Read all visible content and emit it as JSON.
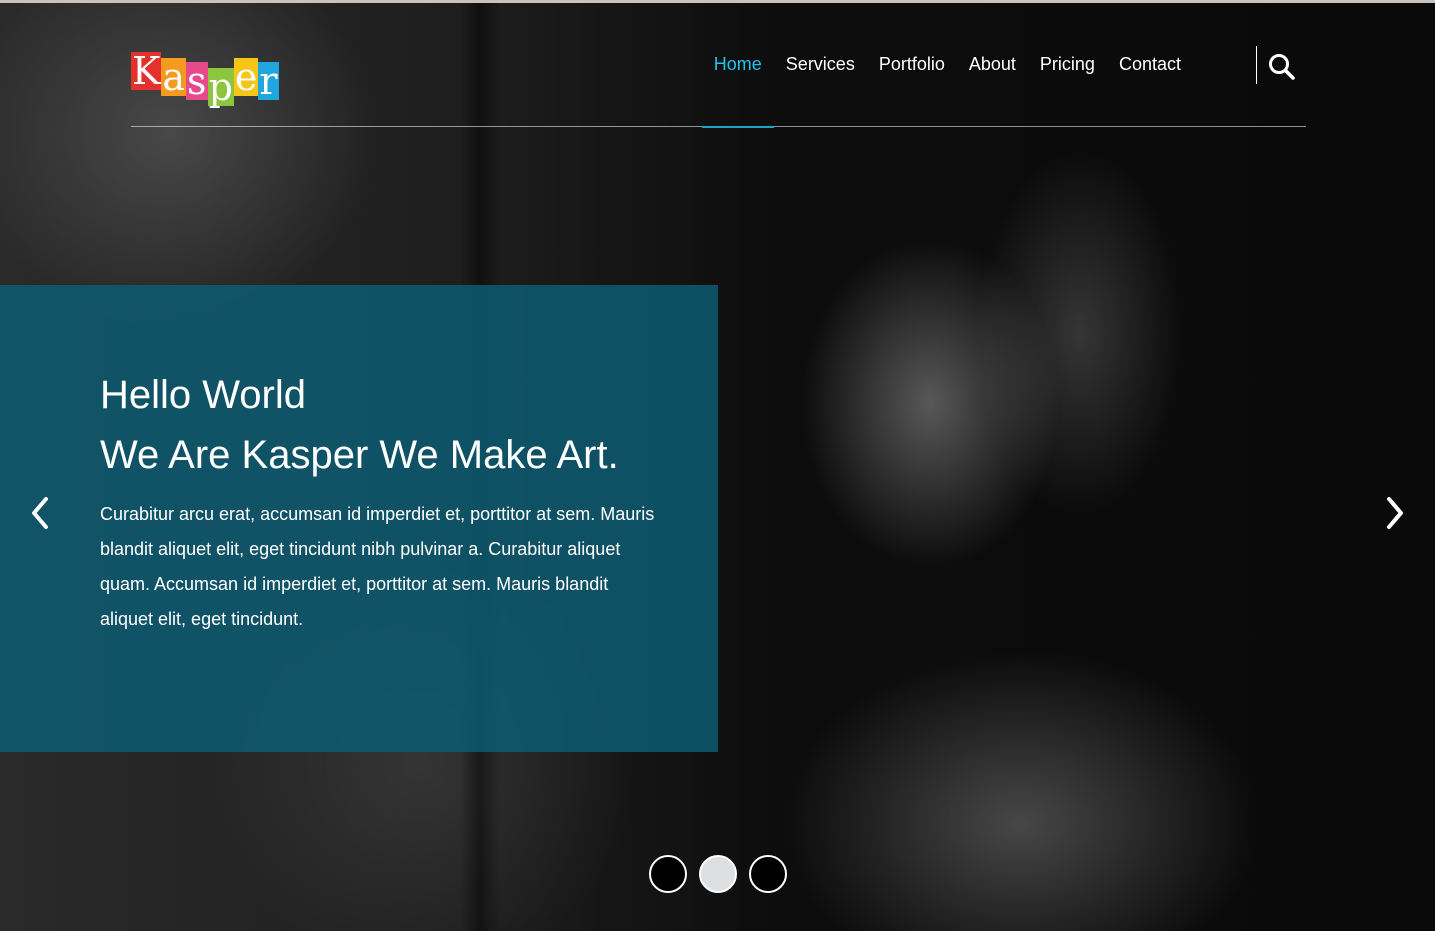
{
  "logo": {
    "text": "Kasper",
    "letter_colors": [
      "#e4312b",
      "#f39a1f",
      "#e64a8b",
      "#8cc63f",
      "#f5c518",
      "#1fa6dc"
    ]
  },
  "nav": {
    "items": [
      {
        "label": "Home",
        "active": true
      },
      {
        "label": "Services",
        "active": false
      },
      {
        "label": "Portfolio",
        "active": false
      },
      {
        "label": "About",
        "active": false
      },
      {
        "label": "Pricing",
        "active": false
      },
      {
        "label": "Contact",
        "active": false
      }
    ],
    "search_icon": "search-icon"
  },
  "hero": {
    "title_line1": "Hello World",
    "title_line2": "We Are Kasper We Make Art.",
    "description": "Curabitur arcu erat, accumsan id imperdiet et, porttitor at sem. Mauris blandit aliquet elit, eget tincidunt nibh pulvinar a. Curabitur aliquet quam. Accumsan id imperdiet et, porttitor at sem. Mauris blandit aliquet elit, eget tincidunt."
  },
  "slider": {
    "prev_icon": "chevron-left-icon",
    "next_icon": "chevron-right-icon",
    "slide_count": 3,
    "active_index": 1
  },
  "colors": {
    "accent": "#1fc2f0",
    "panel": "#0e5c72",
    "active_dot": "#dde0e3"
  }
}
